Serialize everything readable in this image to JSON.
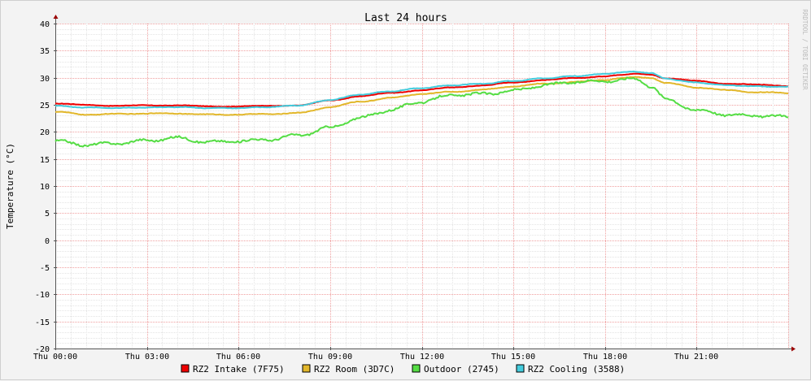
{
  "chart_data": {
    "type": "line",
    "title": "Last 24 hours",
    "ylabel": "Temperature (°C)",
    "xlabel": "",
    "ylim": [
      -20,
      40
    ],
    "yticks": [
      40,
      35,
      30,
      25,
      20,
      15,
      10,
      5,
      0,
      -5,
      -10,
      -15,
      -20
    ],
    "xlim": [
      0,
      24
    ],
    "xticks": [
      {
        "x": 0,
        "label": "Thu 00:00"
      },
      {
        "x": 3,
        "label": "Thu 03:00"
      },
      {
        "x": 6,
        "label": "Thu 06:00"
      },
      {
        "x": 9,
        "label": "Thu 09:00"
      },
      {
        "x": 12,
        "label": "Thu 12:00"
      },
      {
        "x": 15,
        "label": "Thu 15:00"
      },
      {
        "x": 18,
        "label": "Thu 18:00"
      },
      {
        "x": 21,
        "label": "Thu 21:00"
      }
    ],
    "grid": true,
    "legend_position": "bottom",
    "watermark": "RRDTOOL / TOBI OETIKER",
    "x": [
      0,
      1,
      2,
      3,
      4,
      5,
      6,
      7,
      8,
      9,
      10,
      11,
      12,
      13,
      14,
      15,
      16,
      17,
      18,
      18.5,
      19,
      19.5,
      20,
      21,
      22,
      23,
      24
    ],
    "series": [
      {
        "name": "RZ2 Intake (7F75)",
        "color": "#ee0000",
        "values": [
          25.2,
          25.0,
          24.8,
          24.9,
          24.9,
          24.7,
          24.7,
          24.8,
          24.9,
          25.8,
          26.6,
          27.2,
          27.7,
          28.2,
          28.6,
          29.1,
          29.6,
          29.9,
          30.3,
          30.5,
          30.7,
          30.6,
          29.9,
          29.4,
          28.9,
          28.7,
          28.5
        ]
      },
      {
        "name": "RZ2 Room (3D7C)",
        "color": "#e2b72b",
        "values": [
          23.7,
          23.2,
          23.3,
          23.4,
          23.4,
          23.2,
          23.2,
          23.3,
          23.5,
          24.6,
          25.6,
          26.3,
          27.0,
          27.4,
          27.8,
          28.4,
          28.9,
          29.2,
          29.6,
          29.9,
          30.1,
          30.0,
          29.0,
          28.2,
          27.7,
          27.3,
          27.2
        ]
      },
      {
        "name": "Outdoor (2745)",
        "color": "#55dd44",
        "values": [
          18.3,
          17.6,
          17.9,
          18.4,
          18.9,
          18.1,
          18.3,
          18.6,
          19.4,
          20.8,
          22.6,
          24.1,
          25.6,
          26.8,
          27.0,
          27.6,
          28.6,
          29.2,
          29.4,
          29.6,
          29.8,
          28.5,
          26.0,
          24.0,
          23.2,
          23.0,
          22.8
        ]
      },
      {
        "name": "RZ2 Cooling (3588)",
        "color": "#44ccdd",
        "values": [
          24.8,
          24.5,
          24.4,
          24.5,
          24.6,
          24.4,
          24.4,
          24.6,
          24.9,
          25.9,
          26.9,
          27.5,
          28.1,
          28.6,
          28.9,
          29.4,
          29.9,
          30.3,
          30.7,
          31.0,
          31.1,
          30.9,
          29.8,
          29.1,
          28.6,
          28.4,
          28.3
        ]
      }
    ]
  }
}
